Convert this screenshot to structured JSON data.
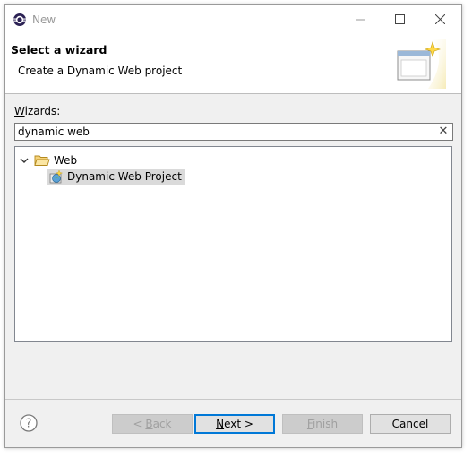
{
  "window": {
    "title": "New"
  },
  "header": {
    "title": "Select a wizard",
    "description": "Create a Dynamic Web project"
  },
  "wizards": {
    "label_mnemonic": "W",
    "label_rest": "izards:",
    "filter_value": "dynamic web",
    "clear_glyph": "✕"
  },
  "tree": {
    "folder": {
      "label": "Web",
      "expanded": true
    },
    "item": {
      "label": "Dynamic Web Project",
      "selected": true
    }
  },
  "buttons": {
    "back": {
      "mnemonic": "B",
      "prefix": "< ",
      "rest": "ack",
      "enabled": false
    },
    "next": {
      "mnemonic": "N",
      "rest": "ext >",
      "enabled": true
    },
    "finish": {
      "mnemonic": "F",
      "rest": "inish",
      "enabled": false
    },
    "cancel": {
      "label": "Cancel",
      "enabled": true
    }
  },
  "colors": {
    "default_button_border": "#0078d7",
    "selection_bg": "#dadada",
    "folder_yellow": "#e8b84a"
  }
}
